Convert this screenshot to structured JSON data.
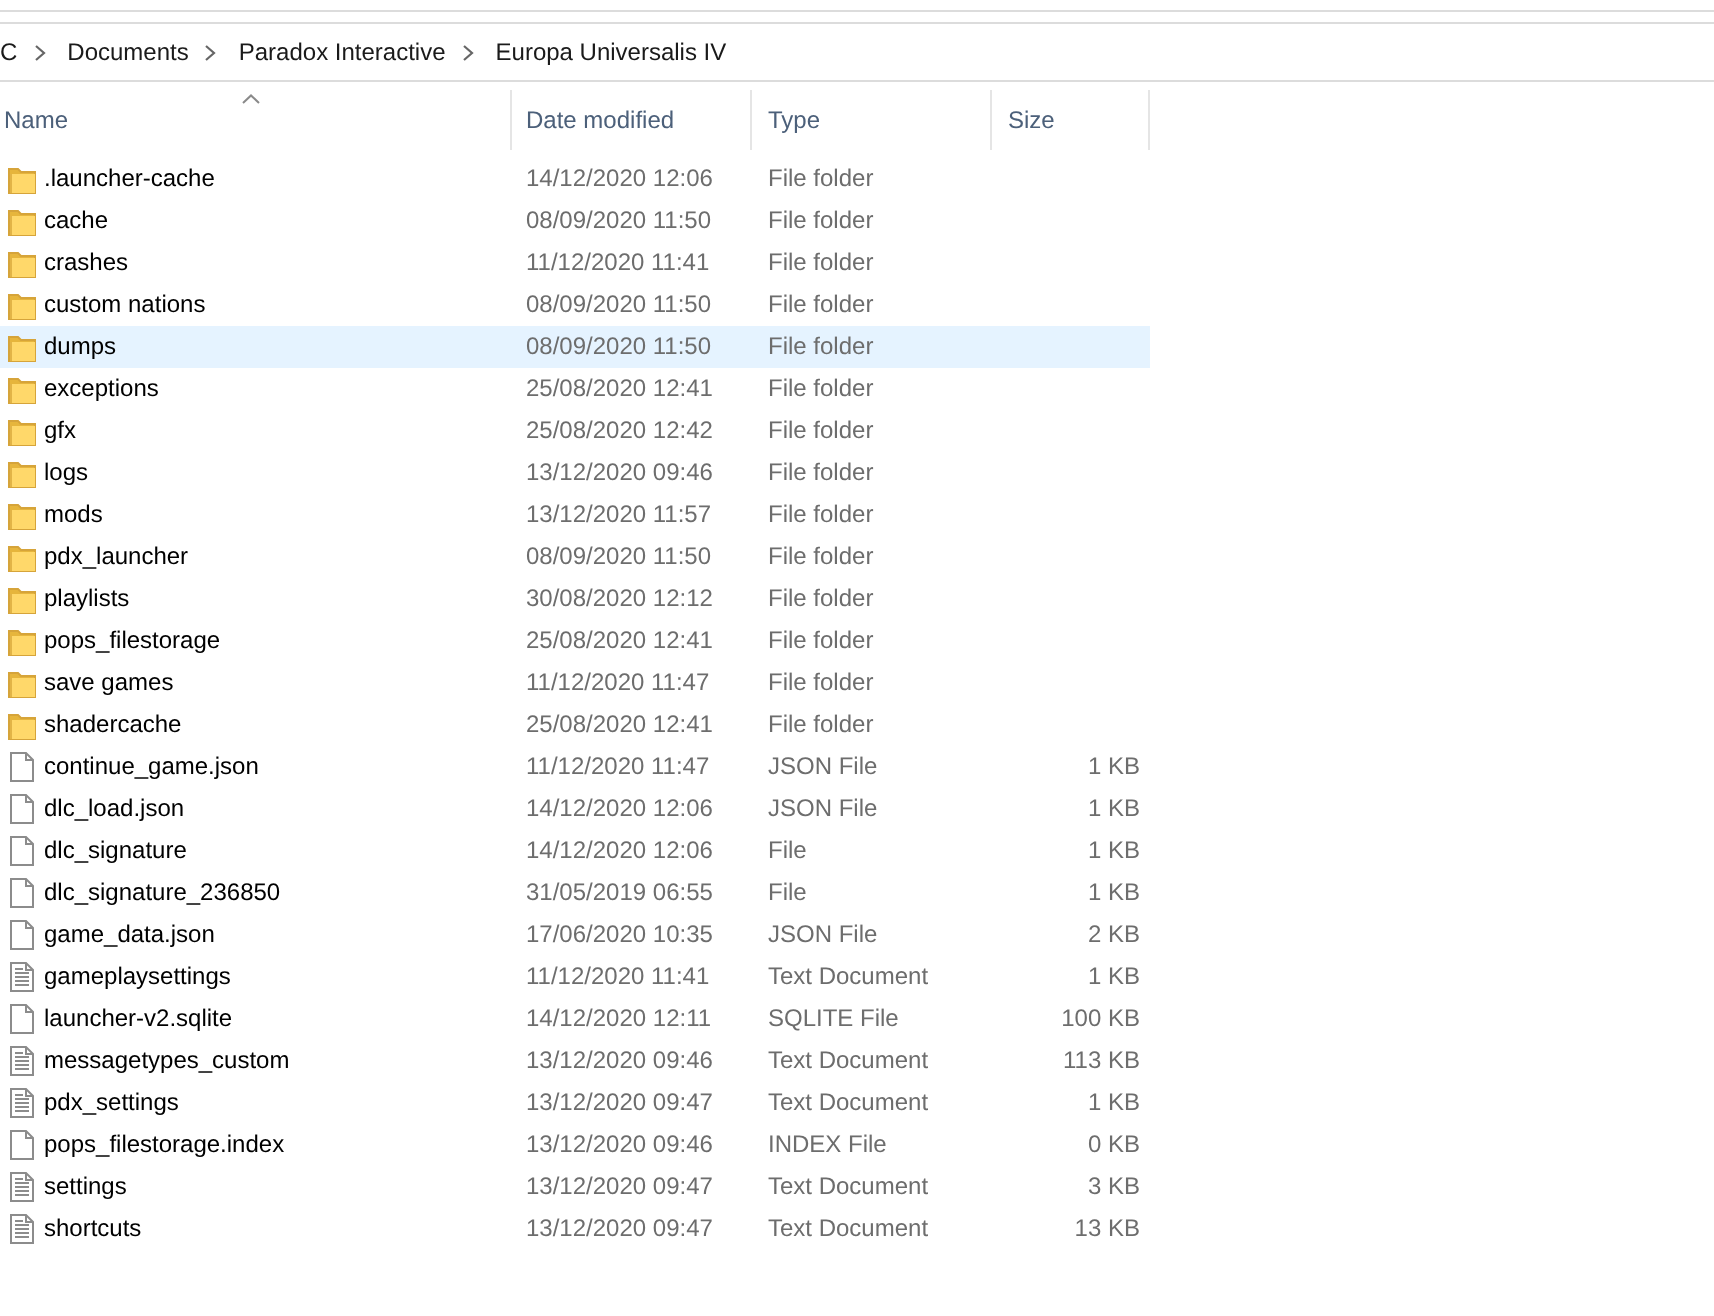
{
  "address_bar": {
    "crumbs": [
      "C",
      "Documents",
      "Paradox Interactive",
      "Europa Universalis IV"
    ]
  },
  "columns": [
    {
      "label": "Name",
      "sorted": true
    },
    {
      "label": "Date modified",
      "sorted": false
    },
    {
      "label": "Type",
      "sorted": false
    },
    {
      "label": "Size",
      "sorted": false
    }
  ],
  "rows": [
    {
      "kind": "folder",
      "name": ".launcher-cache",
      "date": "14/12/2020 12:06",
      "type": "File folder",
      "selected": false
    },
    {
      "kind": "folder",
      "name": "cache",
      "date": "08/09/2020 11:50",
      "type": "File folder",
      "selected": false
    },
    {
      "kind": "folder",
      "name": "crashes",
      "date": "11/12/2020 11:41",
      "type": "File folder",
      "selected": false
    },
    {
      "kind": "folder",
      "name": "custom nations",
      "date": "08/09/2020 11:50",
      "type": "File folder",
      "selected": false
    },
    {
      "kind": "folder",
      "name": "dumps",
      "date": "08/09/2020 11:50",
      "type": "File folder",
      "selected": true
    },
    {
      "kind": "folder",
      "name": "exceptions",
      "date": "25/08/2020 12:41",
      "type": "File folder",
      "selected": false
    },
    {
      "kind": "folder",
      "name": "gfx",
      "date": "25/08/2020 12:42",
      "type": "File folder",
      "selected": false
    },
    {
      "kind": "folder",
      "name": "logs",
      "date": "13/12/2020 09:46",
      "type": "File folder",
      "selected": false
    },
    {
      "kind": "folder",
      "name": "mods",
      "date": "13/12/2020 11:57",
      "type": "File folder",
      "selected": false
    },
    {
      "kind": "folder",
      "name": "pdx_launcher",
      "date": "08/09/2020 11:50",
      "type": "File folder",
      "selected": false
    },
    {
      "kind": "folder",
      "name": "playlists",
      "date": "30/08/2020 12:12",
      "type": "File folder",
      "selected": false
    },
    {
      "kind": "folder",
      "name": "pops_filestorage",
      "date": "25/08/2020 12:41",
      "type": "File folder",
      "selected": false
    },
    {
      "kind": "folder",
      "name": "save games",
      "date": "11/12/2020 11:47",
      "type": "File folder",
      "selected": false
    },
    {
      "kind": "folder",
      "name": "shadercache",
      "date": "25/08/2020 12:41",
      "type": "File folder",
      "selected": false
    },
    {
      "kind": "file",
      "name": "continue_game.json",
      "date": "11/12/2020 11:47",
      "type": "JSON File",
      "size": "1 KB",
      "selected": false
    },
    {
      "kind": "file",
      "name": "dlc_load.json",
      "date": "14/12/2020 12:06",
      "type": "JSON File",
      "size": "1 KB",
      "selected": false
    },
    {
      "kind": "file",
      "name": "dlc_signature",
      "date": "14/12/2020 12:06",
      "type": "File",
      "size": "1 KB",
      "selected": false
    },
    {
      "kind": "file",
      "name": "dlc_signature_236850",
      "date": "31/05/2019 06:55",
      "type": "File",
      "size": "1 KB",
      "selected": false
    },
    {
      "kind": "file",
      "name": "game_data.json",
      "date": "17/06/2020 10:35",
      "type": "JSON File",
      "size": "2 KB",
      "selected": false
    },
    {
      "kind": "text",
      "name": "gameplaysettings",
      "date": "11/12/2020 11:41",
      "type": "Text Document",
      "size": "1 KB",
      "selected": false
    },
    {
      "kind": "file",
      "name": "launcher-v2.sqlite",
      "date": "14/12/2020 12:11",
      "type": "SQLITE File",
      "size": "100 KB",
      "selected": false
    },
    {
      "kind": "text",
      "name": "messagetypes_custom",
      "date": "13/12/2020 09:46",
      "type": "Text Document",
      "size": "113 KB",
      "selected": false
    },
    {
      "kind": "text",
      "name": "pdx_settings",
      "date": "13/12/2020 09:47",
      "type": "Text Document",
      "size": "1 KB",
      "selected": false
    },
    {
      "kind": "file",
      "name": "pops_filestorage.index",
      "date": "13/12/2020 09:46",
      "type": "INDEX File",
      "size": "0 KB",
      "selected": false
    },
    {
      "kind": "text",
      "name": "settings",
      "date": "13/12/2020 09:47",
      "type": "Text Document",
      "size": "3 KB",
      "selected": false
    },
    {
      "kind": "text",
      "name": "shortcuts",
      "date": "13/12/2020 09:47",
      "type": "Text Document",
      "size": "13 KB",
      "selected": false
    }
  ]
}
